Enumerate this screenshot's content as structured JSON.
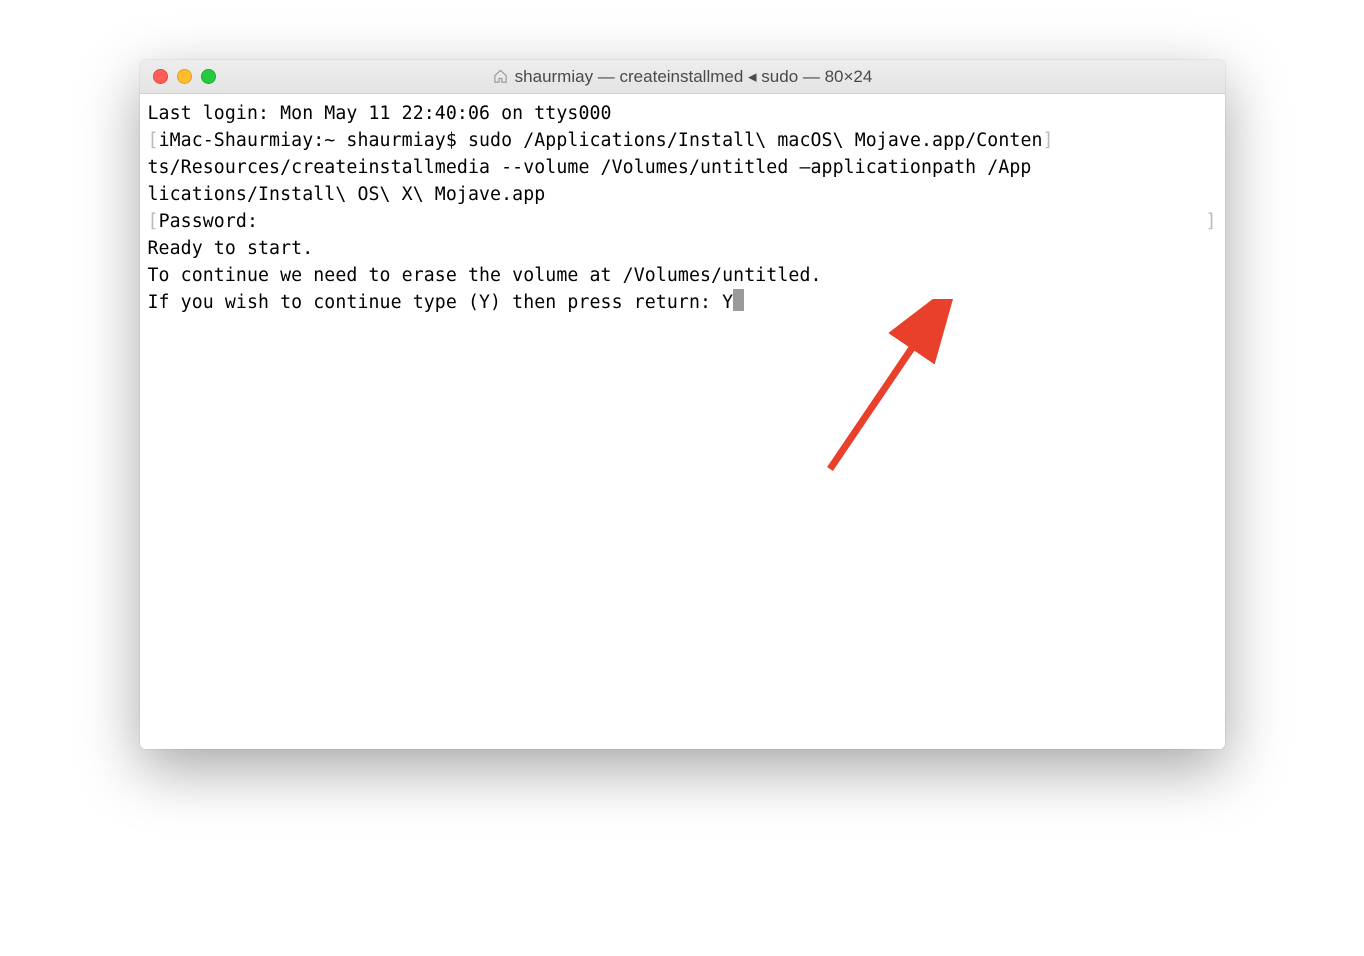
{
  "window": {
    "title": "shaurmiay — createinstallmed ◂ sudo — 80×24"
  },
  "terminal": {
    "line1": "Last login: Mon May 11 22:40:06 on ttys000",
    "line2_prefix": "[",
    "line2": "iMac-Shaurmiay:~ shaurmiay$ sudo /Applications/Install\\ macOS\\ Mojave.app/Conten",
    "line2_suffix": "]",
    "line3": "ts/Resources/createinstallmedia --volume /Volumes/untitled —applicationpath /App",
    "line4": "lications/Install\\ OS\\ X\\ Mojave.app",
    "line5_prefix": "[",
    "line5": "Password:",
    "line5_suffix": "]",
    "line6": "Ready to start.",
    "line7": "To continue we need to erase the volume at /Volumes/untitled.",
    "line8": "If you wish to continue type (Y) then press return: Y"
  }
}
